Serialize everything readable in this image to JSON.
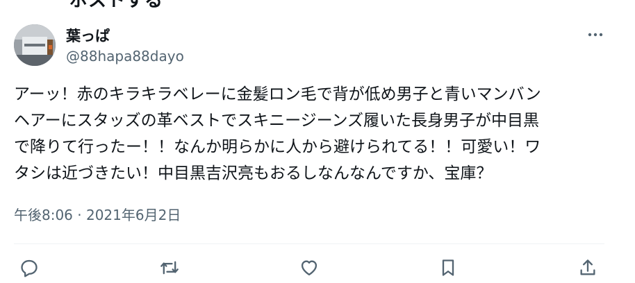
{
  "header": {
    "cutoff_text": "ポストする"
  },
  "user": {
    "display_name": "葉っぱ",
    "handle": "@88hapa88dayo"
  },
  "tweet": {
    "lines": [
      "アーッ！赤のキラキラベレーに金髪ロン毛で背が低め男子と青いマンバン",
      "ヘアーにスタッズの革ベストでスキニージーンズ履いた長身男子が中目黒",
      "で降りて行ったー！！なんか明らかに人から避けられてる！！可愛い！ワ",
      "タシは近づきたい！中目黒吉沢亮もおるしなんなんですか、宝庫？"
    ],
    "timestamp": "午後8:06 · 2021年6月2日"
  },
  "icons": {
    "more": "more-horizontal-icon",
    "reply": "reply-icon",
    "retweet": "retweet-icon",
    "like": "heart-icon",
    "bookmark": "bookmark-icon",
    "share": "share-icon"
  },
  "colors": {
    "text": "#0f1419",
    "secondary": "#536471",
    "divider": "#eff3f4"
  }
}
